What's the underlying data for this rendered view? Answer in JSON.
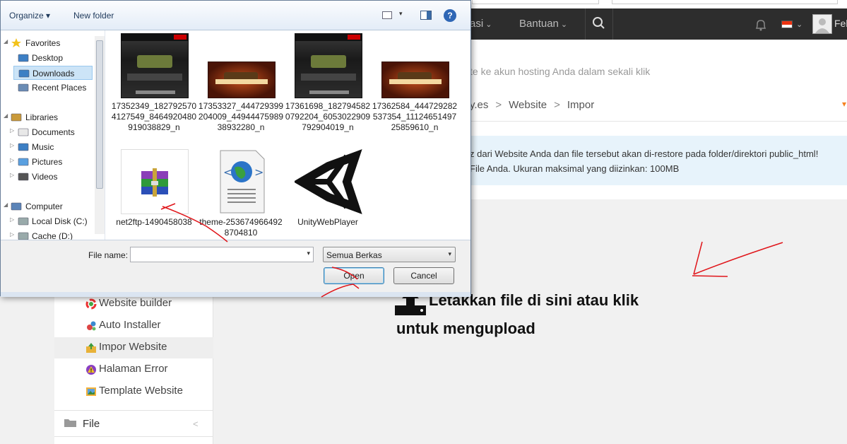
{
  "webpage": {
    "nav": {
      "items": [
        {
          "label": "asi",
          "chev": "⌄"
        },
        {
          "label": "Bantuan",
          "chev": "⌄"
        }
      ],
      "username": "Feb"
    },
    "subtitle": "te ke akun hosting Anda dalam sekali klik",
    "breadcrumb": [
      "y.es",
      "Website",
      "Impor"
    ],
    "breadcrumb_sep": ">",
    "info_line1": "z dari Website Anda dan file tersebut akan di-restore pada folder/direktori public_html!",
    "info_line2": "File Anda. Ukuran maksimal yang diizinkan: 100MB",
    "sidebar": [
      {
        "label": "Website builder",
        "icon": "color-wheel-icon"
      },
      {
        "label": "Auto Installer",
        "icon": "gears-icon"
      },
      {
        "label": "Impor Website",
        "icon": "import-box-icon",
        "active": true
      },
      {
        "label": "Halaman Error",
        "icon": "warning-icon"
      },
      {
        "label": "Template Website",
        "icon": "picture-icon"
      }
    ],
    "sidebar_file": {
      "label": "File",
      "chev": "<"
    },
    "dropzone": {
      "line1": "Letakkan file di sini atau klik",
      "line2": "untuk mengupload"
    }
  },
  "dialog": {
    "toolbar": {
      "organize": "Organize",
      "organize_chev": "▾",
      "new_folder": "New folder",
      "views_chev": "▾",
      "help": "?"
    },
    "nav": [
      {
        "label": "Favorites",
        "icon": "star-icon",
        "arrow": "◢"
      },
      {
        "label": "Desktop",
        "icon": "desktop-icon"
      },
      {
        "label": "Downloads",
        "icon": "downloads-icon",
        "selected": true
      },
      {
        "label": "Recent Places",
        "icon": "recent-places-icon"
      },
      {
        "label": "Libraries",
        "icon": "libraries-icon",
        "arrow": "◢"
      },
      {
        "label": "Documents",
        "icon": "documents-icon",
        "arrow": "▷"
      },
      {
        "label": "Music",
        "icon": "music-icon",
        "arrow": "▷"
      },
      {
        "label": "Pictures",
        "icon": "pictures-icon",
        "arrow": "▷"
      },
      {
        "label": "Videos",
        "icon": "videos-icon",
        "arrow": "▷"
      },
      {
        "label": "Computer",
        "icon": "computer-icon",
        "arrow": "◢"
      },
      {
        "label": "Local Disk (C:)",
        "icon": "disk-icon",
        "arrow": "▷"
      },
      {
        "label": "Cache (D:)",
        "icon": "disk-icon",
        "arrow": "▷"
      }
    ],
    "files": [
      {
        "name": "17352349_1827925704127549_8464920480919038829_n",
        "thumb": "pb"
      },
      {
        "name": "17353327_444729399204009_4494447598938932280_n",
        "thumb": "orange"
      },
      {
        "name": "17361698_1827945820792204_6053022909792904019_n",
        "thumb": "pb"
      },
      {
        "name": "17362584_444729282537354_1112465149725859610_n",
        "thumb": "orange"
      },
      {
        "name": "net2ftp-1490458038",
        "thumb": "winrar"
      },
      {
        "name": "theme-2536749664928704810",
        "thumb": "html"
      },
      {
        "name": "UnityWebPlayer",
        "thumb": "unity"
      }
    ],
    "file_name_label": "File name:",
    "file_name_value": "",
    "filter_chev": "▾",
    "filter_value": "Semua Berkas",
    "open_label": "Open",
    "cancel_label": "Cancel"
  },
  "colors": {
    "navbar": "#2d2d2d",
    "info_bg": "#e7f3fb",
    "accent_orange": "#f58220",
    "annotation": "#e0151a"
  }
}
